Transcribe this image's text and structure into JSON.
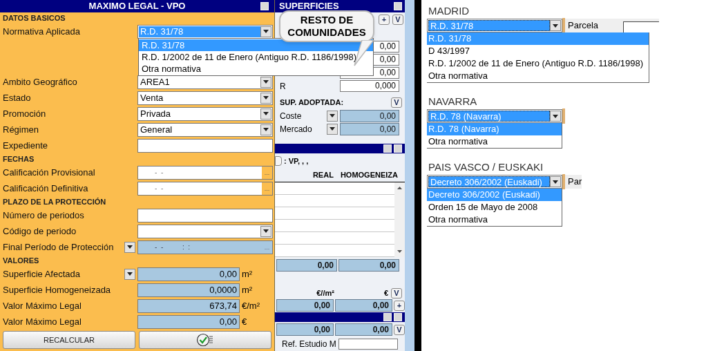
{
  "left_panel": {
    "title": "MAXIMO LEGAL - VPO",
    "checkboxes": [
      {
        "checked": false
      }
    ],
    "sections": [
      {
        "heading": "DATOS BASICOS",
        "fields": [
          {
            "kind": "select",
            "label": "Normativa Aplicada",
            "value": "R.D. 31/78",
            "highlighted": true,
            "options": [
              {
                "label": "R.D. 31/78",
                "selected": true
              },
              {
                "label": "R.D. 1/2002 de 11 de Enero (Antiguo R.D. 1186/1998)",
                "selected": false
              },
              {
                "label": "Otra normativa",
                "selected": false
              }
            ]
          },
          {
            "kind": "select",
            "label": "Ambito Geográfico",
            "value": "AREA1",
            "highlighted": false
          },
          {
            "kind": "select",
            "label": "Estado",
            "value": "Venta",
            "highlighted": false
          },
          {
            "kind": "select",
            "label": "Promoción",
            "value": "Privada",
            "highlighted": false
          },
          {
            "kind": "select",
            "label": "Régimen",
            "value": "General",
            "highlighted": false
          },
          {
            "kind": "text",
            "label": "Expediente"
          }
        ]
      },
      {
        "heading": "FECHAS",
        "fields": [
          {
            "kind": "date",
            "label": "Calificación Provisional",
            "value": "-  -",
            "button": "..."
          },
          {
            "kind": "date",
            "label": "Calificación Definitiva",
            "value": "-  -",
            "button": "..."
          }
        ]
      },
      {
        "heading": "PLAZO DE LA PROTECCIÓN",
        "fields": [
          {
            "kind": "text",
            "label": "Número de periodos"
          },
          {
            "kind": "select",
            "label": "Código de periodo"
          },
          {
            "kind": "calc_date",
            "label": "Final Período de Protección",
            "value": "-  -          :  :",
            "button": "..."
          }
        ]
      },
      {
        "heading": "VALORES",
        "fields": [
          {
            "kind": "number",
            "label": "Superficie Afectada",
            "value": "0,00",
            "unit": "m²",
            "menu": true
          },
          {
            "kind": "number",
            "label": "Superficie Homogeneizada",
            "value": "0,0000",
            "unit": "m²",
            "menu": false
          },
          {
            "kind": "number",
            "label": "Valor Máximo Legal",
            "value": "673,74",
            "unit": "€/m²",
            "menu": false
          },
          {
            "kind": "number",
            "label": "Valor Máximo Legal",
            "value": "0,00",
            "unit": "€",
            "menu": false
          }
        ]
      }
    ],
    "buttons": [
      {
        "kind": "text",
        "label": "RECALCULAR"
      },
      {
        "kind": "confirm"
      }
    ]
  },
  "callout": {
    "text": "RESTO DE COMUNIDADES"
  },
  "surfaces_panel": {
    "title": "SUPERFICIES",
    "checkboxes": [
      {
        "checked": false
      }
    ],
    "buttons": [
      "+",
      "V"
    ],
    "values": [
      "0,00",
      "0,00",
      "0,00"
    ],
    "r_row": {
      "label": "R",
      "value": "0,000"
    },
    "adopted": {
      "heading": "SUP. ADOPTADA:",
      "button": "V",
      "rows": [
        {
          "label": "Coste",
          "value": "0,00"
        },
        {
          "label": "Mercado",
          "value": "0,00"
        }
      ]
    }
  },
  "vp_panel": {
    "checkboxes": [
      {
        "checked": false
      },
      {
        "checked": false
      }
    ],
    "option_label": ": VP, , ,",
    "columns": [
      "REAL",
      "HOMOGENEIZA"
    ],
    "totals": [
      "0,00",
      "0,00"
    ],
    "unit_headers": [
      "€//m²",
      "€"
    ],
    "unit_button": "V",
    "unit_values": [
      "0,00",
      "0,00"
    ],
    "add_button": "+"
  },
  "bottom_panel": {
    "checkboxes": [
      {
        "checked": false
      },
      {
        "checked": false
      }
    ],
    "values": [
      "0,00",
      "0,00"
    ],
    "button": "V",
    "ref_label": "Ref. Estudio M"
  },
  "regions": [
    {
      "name": "MADRID",
      "value": "R.D. 31/78",
      "highlighted": true,
      "side_label": "Parcela",
      "side_field": true,
      "options": [
        {
          "label": "R.D. 31/78",
          "selected": true
        },
        {
          "label": "D 43/1997",
          "selected": false
        },
        {
          "label": "R.D. 1/2002 de 11 de Enero (Antiguo R.D. 1186/1998)",
          "selected": false
        },
        {
          "label": "Otra normativa",
          "selected": false
        }
      ]
    },
    {
      "name": "NAVARRA",
      "value": "R.D. 78 (Navarra)",
      "highlighted": true,
      "options": [
        {
          "label": "R.D. 78 (Navarra)",
          "selected": true
        },
        {
          "label": "Otra normativa",
          "selected": false
        }
      ]
    },
    {
      "name": "PAIS VASCO / EUSKAKI",
      "value": "Decreto 306/2002 (Euskadi)",
      "highlighted": true,
      "side_label": "Par",
      "side_field": false,
      "options": [
        {
          "label": "Decreto 306/2002 (Euskadi)",
          "selected": true
        },
        {
          "label": "Orden 15 de Mayo de 2008",
          "selected": false
        },
        {
          "label": "Otra normativa",
          "selected": false
        }
      ]
    }
  ]
}
